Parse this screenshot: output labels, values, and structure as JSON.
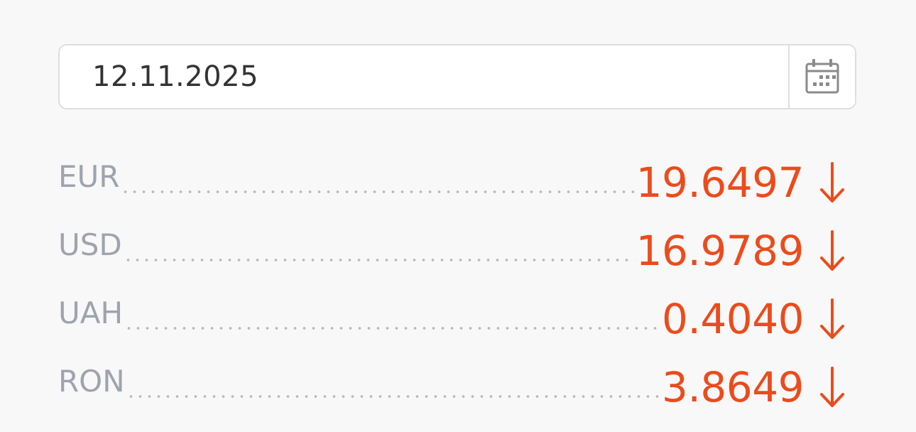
{
  "date_picker": {
    "value": "12.11.2025",
    "icon": "calendar-icon"
  },
  "rates": [
    {
      "code": "EUR",
      "value": "19.6497",
      "trend": "down",
      "arrow": "↓"
    },
    {
      "code": "USD",
      "value": "16.9789",
      "trend": "down",
      "arrow": "↓"
    },
    {
      "code": "UAH",
      "value": "0.4040",
      "trend": "down",
      "arrow": "↓"
    },
    {
      "code": "RON",
      "value": "3.8649",
      "trend": "down",
      "arrow": "↓"
    }
  ],
  "colors": {
    "background": "#f8f8f8",
    "code_text": "#9ea3ae",
    "value_down": "#ec4b1b",
    "border": "#dedede"
  }
}
